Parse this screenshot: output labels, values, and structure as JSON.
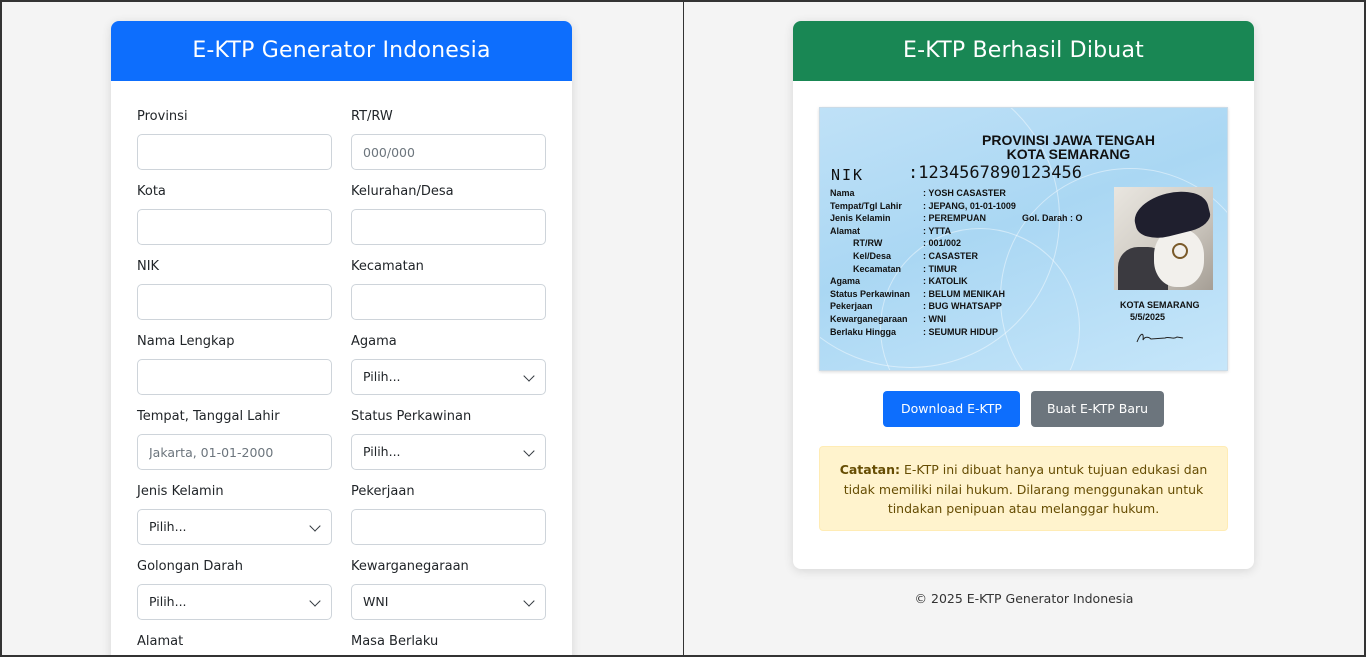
{
  "form": {
    "title": "E-KTP Generator Indonesia",
    "fields": {
      "provinsi": {
        "label": "Provinsi",
        "placeholder": ""
      },
      "rtrw": {
        "label": "RT/RW",
        "placeholder": "000/000"
      },
      "kota": {
        "label": "Kota",
        "placeholder": ""
      },
      "kelurahan": {
        "label": "Kelurahan/Desa",
        "placeholder": ""
      },
      "nik": {
        "label": "NIK",
        "placeholder": ""
      },
      "kecamatan": {
        "label": "Kecamatan",
        "placeholder": ""
      },
      "nama": {
        "label": "Nama Lengkap",
        "placeholder": ""
      },
      "agama": {
        "label": "Agama",
        "value": "Pilih..."
      },
      "ttl": {
        "label": "Tempat, Tanggal Lahir",
        "placeholder": "Jakarta, 01-01-2000"
      },
      "status": {
        "label": "Status Perkawinan",
        "value": "Pilih..."
      },
      "jk": {
        "label": "Jenis Kelamin",
        "value": "Pilih..."
      },
      "pekerjaan": {
        "label": "Pekerjaan",
        "placeholder": ""
      },
      "goldar": {
        "label": "Golongan Darah",
        "value": "Pilih..."
      },
      "wn": {
        "label": "Kewarganegaraan",
        "value": "WNI"
      },
      "alamat": {
        "label": "Alamat"
      },
      "masa": {
        "label": "Masa Berlaku"
      }
    }
  },
  "result": {
    "title": "E-KTP Berhasil Dibuat",
    "ktp": {
      "provinsi": "PROVINSI JAWA TENGAH",
      "kota": "KOTA SEMARANG",
      "nik_label": "NIK",
      "nik_value": ":1234567890123456",
      "rows": [
        {
          "k": "Nama",
          "v": ": YOSH CASASTER"
        },
        {
          "k": "Tempat/Tgl Lahir",
          "v": ": JEPANG, 01-01-1009"
        },
        {
          "k": "Jenis Kelamin",
          "v": ": PEREMPUAN"
        },
        {
          "k": "Alamat",
          "v": ": YTTA"
        },
        {
          "k": "RT/RW",
          "v": ": 001/002"
        },
        {
          "k": "Kel/Desa",
          "v": ": CASASTER"
        },
        {
          "k": "Kecamatan",
          "v": ": TIMUR"
        },
        {
          "k": "Agama",
          "v": ": KATOLIK"
        },
        {
          "k": "Status Perkawinan",
          "v": ": BELUM MENIKAH"
        },
        {
          "k": "Pekerjaan",
          "v": ": BUG WHATSAPP"
        },
        {
          "k": "Kewarganegaraan",
          "v": ": WNI"
        },
        {
          "k": "Berlaku Hingga",
          "v": ": SEUMUR HIDUP"
        }
      ],
      "gol_darah": "Gol. Darah : O",
      "issue_city": "KOTA SEMARANG",
      "issue_date": "5/5/2025"
    },
    "download_label": "Download E-KTP",
    "new_label": "Buat E-KTP Baru",
    "note_bold": "Catatan:",
    "note_text": " E-KTP ini dibuat hanya untuk tujuan edukasi dan tidak memiliki nilai hukum. Dilarang menggunakan untuk tindakan penipuan atau melanggar hukum."
  },
  "footer": "© 2025 E-KTP Generator Indonesia",
  "colors": {
    "primary": "#0d6efd",
    "success": "#198754",
    "secondary": "#6c757d",
    "warning_bg": "#fff3cd"
  }
}
